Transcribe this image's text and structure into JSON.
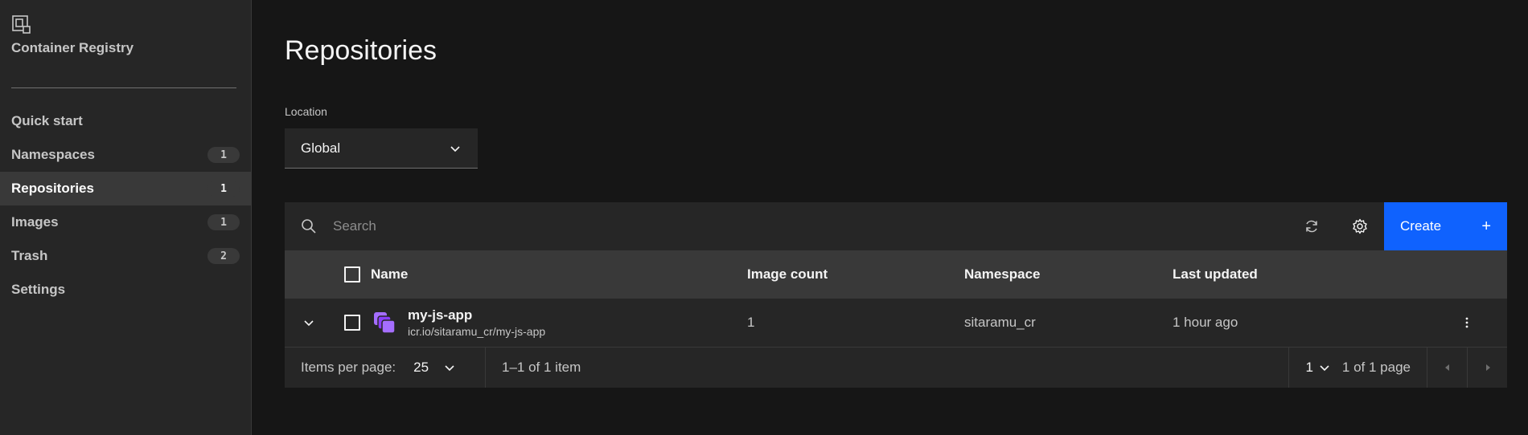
{
  "sidebar": {
    "title": "Container Registry",
    "items": [
      {
        "label": "Quick start",
        "badge": ""
      },
      {
        "label": "Namespaces",
        "badge": "1"
      },
      {
        "label": "Repositories",
        "badge": "1"
      },
      {
        "label": "Images",
        "badge": "1"
      },
      {
        "label": "Trash",
        "badge": "2"
      },
      {
        "label": "Settings",
        "badge": ""
      }
    ]
  },
  "page": {
    "title": "Repositories",
    "location_label": "Location",
    "location_value": "Global"
  },
  "toolbar": {
    "search_placeholder": "Search",
    "create_label": "Create",
    "create_plus": "+"
  },
  "table": {
    "columns": [
      "Name",
      "Image count",
      "Namespace",
      "Last updated"
    ],
    "rows": [
      {
        "name": "my-js-app",
        "path": "icr.io/sitaramu_cr/my-js-app",
        "image_count": "1",
        "namespace": "sitaramu_cr",
        "last_updated": "1 hour ago"
      }
    ]
  },
  "pagination": {
    "items_per_page_label": "Items per page:",
    "page_size": "25",
    "range": "1–1 of 1 item",
    "current_page": "1",
    "page_of": "1 of 1 page"
  },
  "colors": {
    "accent": "#0f62fe",
    "icon_purple": "#a56eff"
  },
  "icons": [
    "registry-logo-icon",
    "chevron-down-icon",
    "search-icon",
    "refresh-icon",
    "gear-icon",
    "plus-icon",
    "repository-icon",
    "overflow-menu-icon",
    "caret-left-icon",
    "caret-right-icon"
  ]
}
